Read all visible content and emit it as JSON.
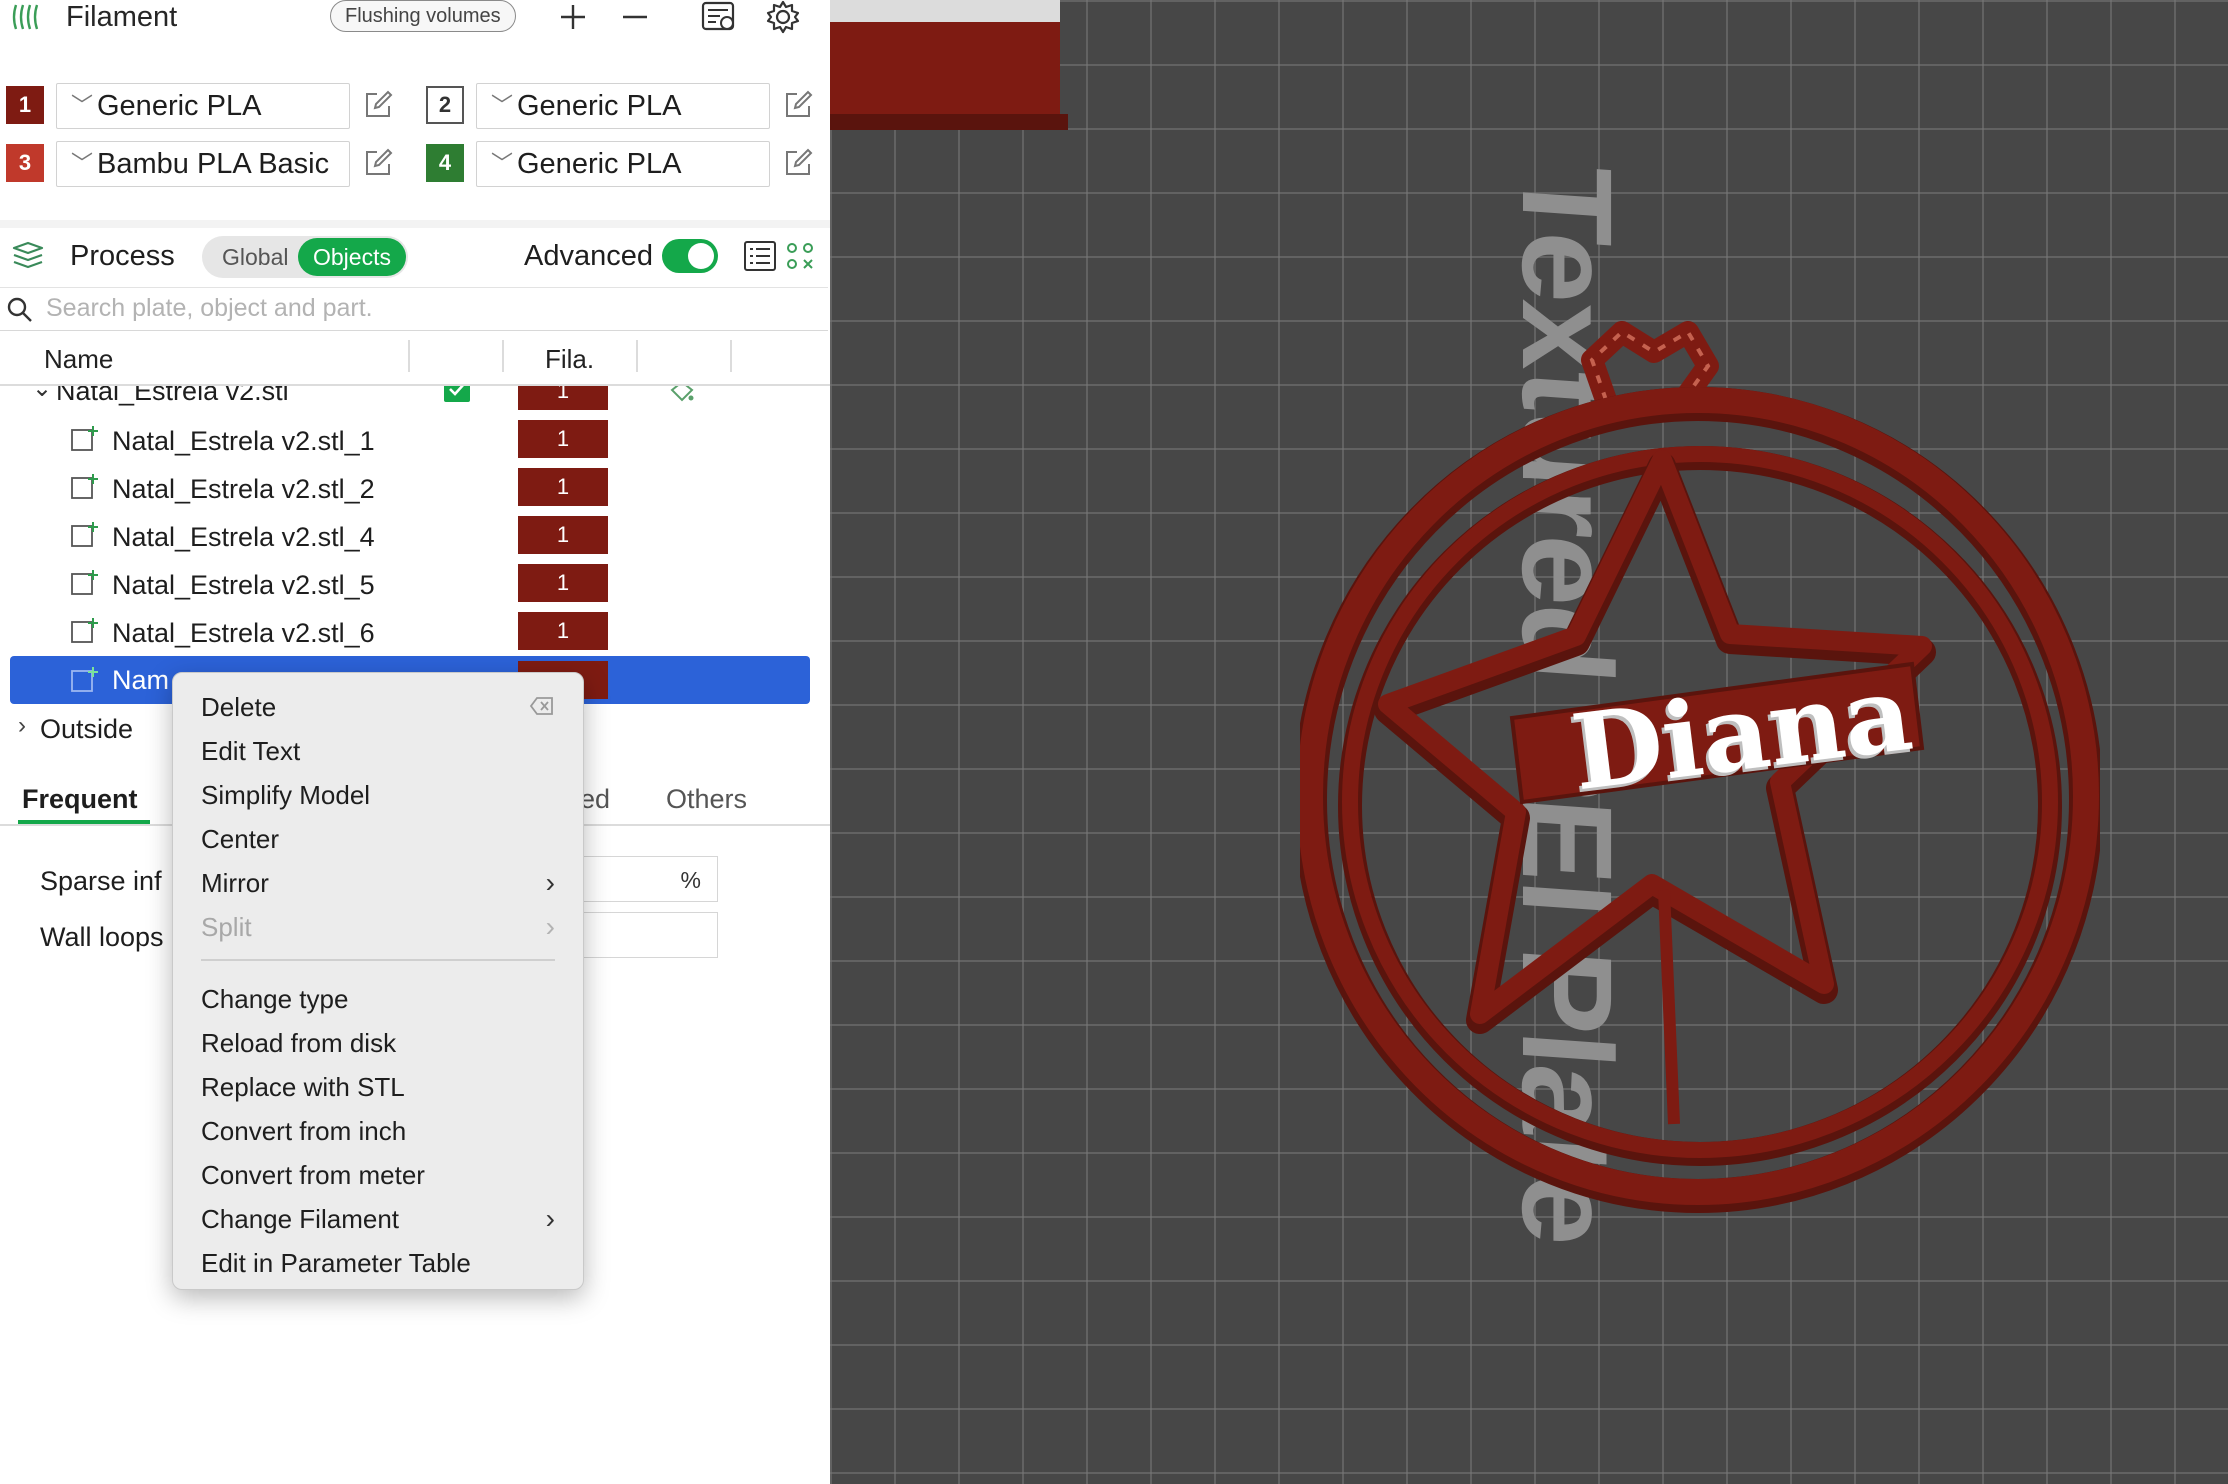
{
  "filament": {
    "title": "Filament",
    "flushing_label": "Flushing volumes",
    "slots": [
      {
        "num": "1",
        "name": "Generic PLA",
        "color": "#7e1b12"
      },
      {
        "num": "2",
        "name": "Generic PLA",
        "color": "#ffffff"
      },
      {
        "num": "3",
        "name": "Bambu PLA Basic",
        "color": "#c0392b"
      },
      {
        "num": "4",
        "name": "Generic PLA",
        "color": "#2e7d32"
      }
    ]
  },
  "process": {
    "title": "Process",
    "global_label": "Global",
    "objects_label": "Objects",
    "advanced_label": "Advanced",
    "advanced_on": true
  },
  "search": {
    "placeholder": "Search plate, object and part."
  },
  "table": {
    "col_name": "Name",
    "col_fila": "Fila.",
    "object_name": "Natal_Estrela v2.stl",
    "object_fila": "1",
    "parts": [
      {
        "name": "Natal_Estrela v2.stl_1",
        "fila": "1"
      },
      {
        "name": "Natal_Estrela v2.stl_2",
        "fila": "1"
      },
      {
        "name": "Natal_Estrela v2.stl_4",
        "fila": "1"
      },
      {
        "name": "Natal_Estrela v2.stl_5",
        "fila": "1"
      },
      {
        "name": "Natal_Estrela v2.stl_6",
        "fila": "1"
      }
    ],
    "selected_name": "Nam",
    "outside_label": "Outside"
  },
  "tabs": {
    "frequent": "Frequent",
    "partial": "ed",
    "others": "Others"
  },
  "settings": {
    "sparse_label": "Sparse inf",
    "sparse_unit": "%",
    "wall_label": "Wall loops"
  },
  "menu": {
    "delete": "Delete",
    "edit_text": "Edit Text",
    "simplify": "Simplify Model",
    "center": "Center",
    "mirror": "Mirror",
    "split": "Split",
    "change_type": "Change type",
    "reload": "Reload from disk",
    "replace": "Replace with STL",
    "inch": "Convert from inch",
    "meter": "Convert from meter",
    "change_filament": "Change Filament",
    "param_table": "Edit in Parameter Table"
  },
  "viewport": {
    "plate_label": "Textured PEI Plate",
    "model_text": "Diana",
    "model_color": "#7e1b12"
  }
}
